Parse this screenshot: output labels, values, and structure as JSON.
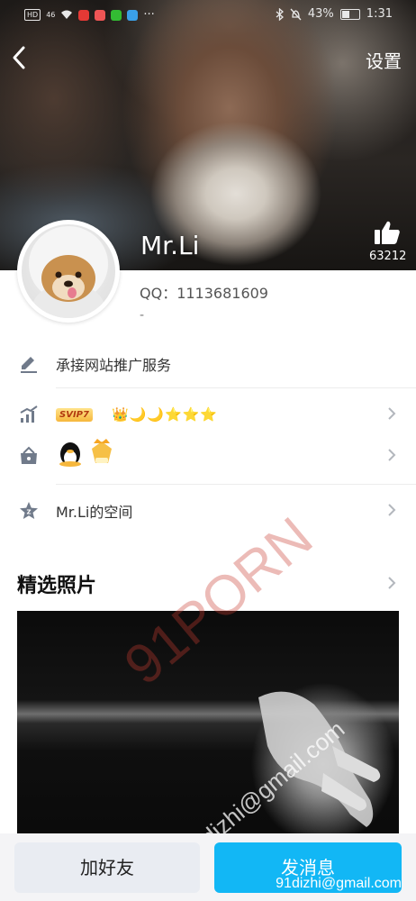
{
  "status_bar": {
    "network": "HD",
    "signal": "46",
    "battery": "43%",
    "time": "1:31",
    "more": "···"
  },
  "header": {
    "settings_label": "设置",
    "like_count": "63212",
    "username": "Mr.Li"
  },
  "profile": {
    "qq_label": "QQ：1113681609",
    "signature": "-"
  },
  "rows": {
    "service_label": "承接网站推广服务",
    "svip_badge": "SVIP7",
    "level_icons": "👑🌙🌙⭐⭐⭐",
    "space_label": "Mr.Li的空间"
  },
  "photos": {
    "section_title": "精选照片"
  },
  "watermark": {
    "big": "91PORN",
    "email": "91dizhi@gmail.com"
  },
  "bottom_bar": {
    "add_friend": "加好友",
    "send_message": "发消息",
    "email_overlay": "91dizhi@gmail.com"
  },
  "colors": {
    "accent": "#12b7f5",
    "secondary_button": "#e9ecf2"
  }
}
